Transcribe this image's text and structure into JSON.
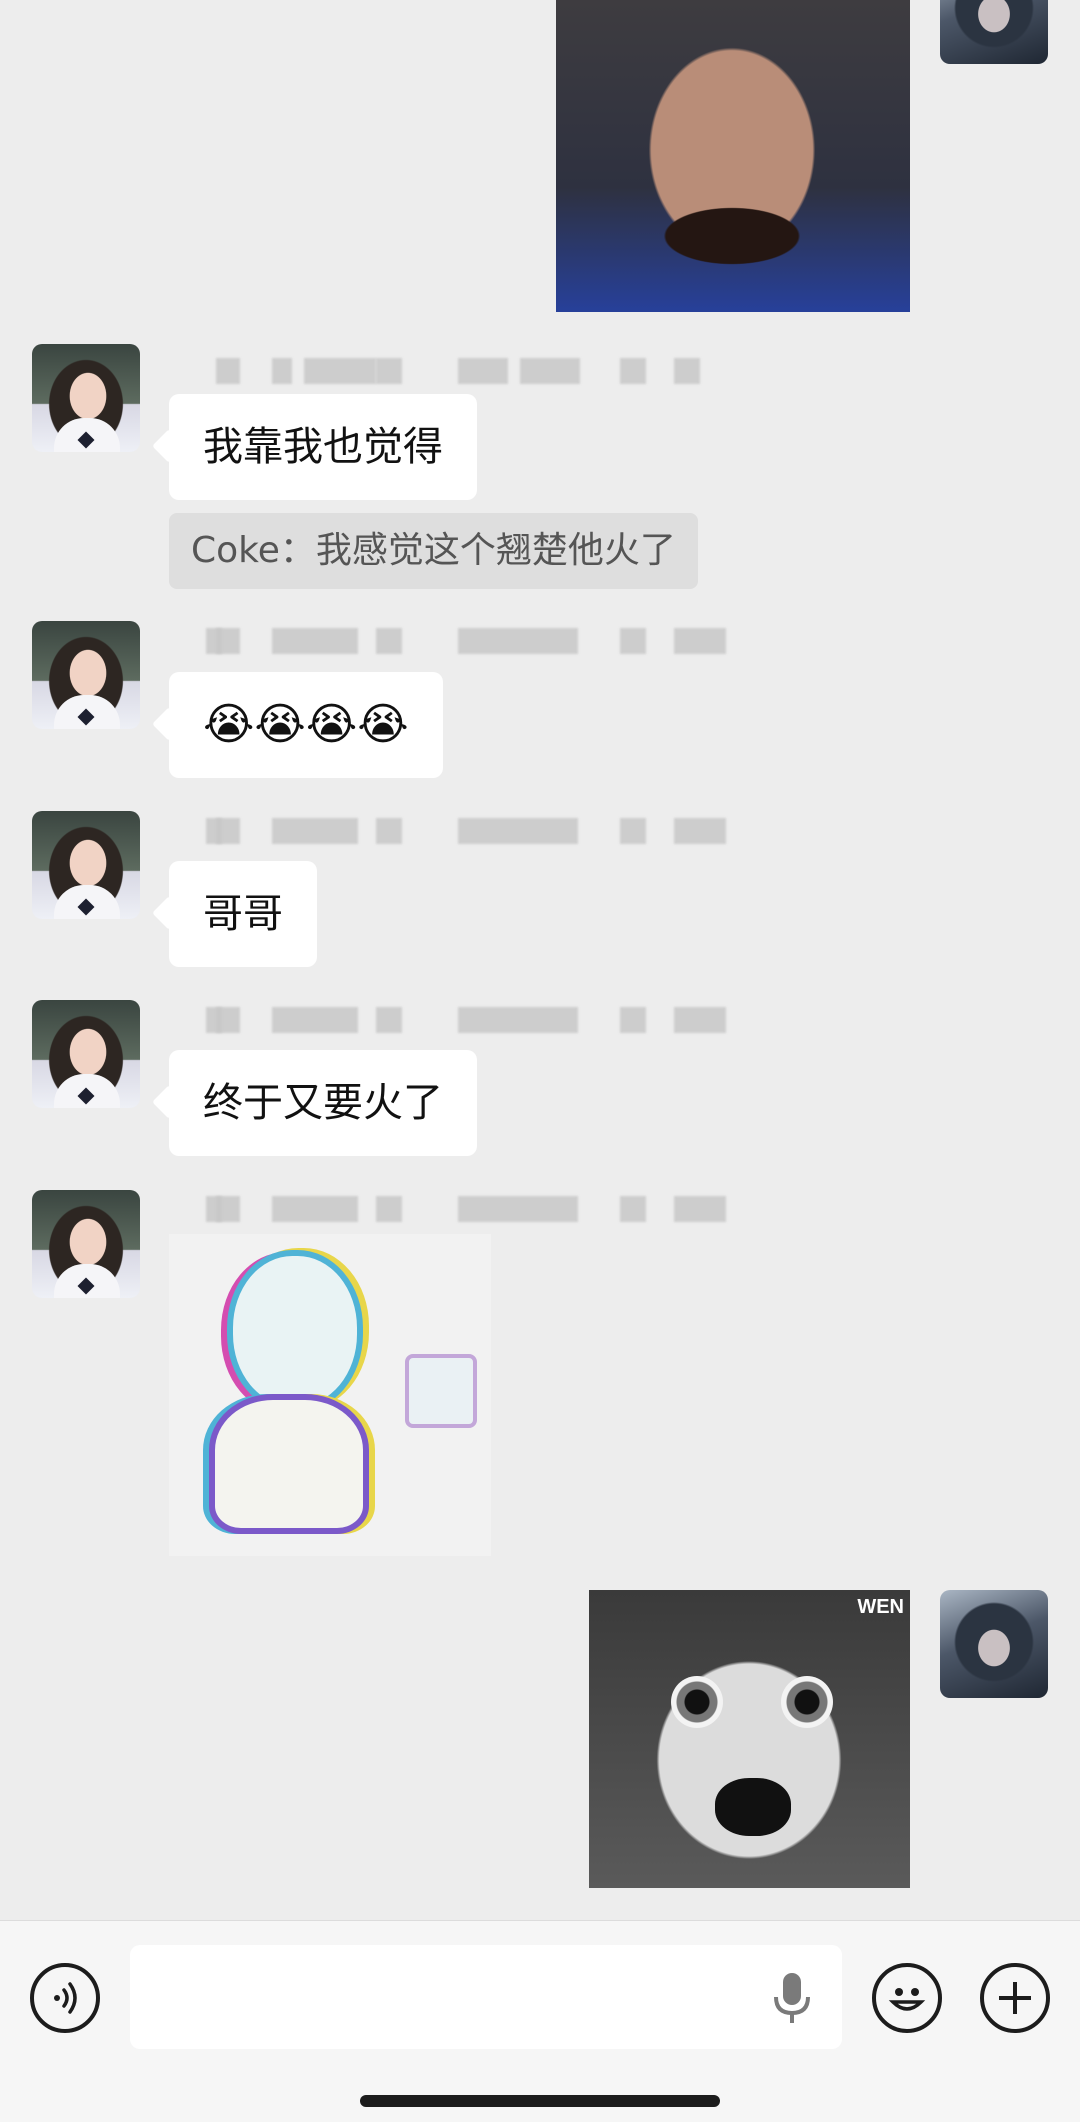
{
  "messages": [
    {
      "sender": "other",
      "text": "我靠我也觉得",
      "quote": "Coke：我感觉这个翘楚他火了"
    },
    {
      "sender": "other",
      "text": "😭😭😭😭"
    },
    {
      "sender": "other",
      "text": "哥哥"
    },
    {
      "sender": "other",
      "text": "终于又要火了"
    }
  ],
  "stickers": {
    "ghost_watermark": "WEN"
  },
  "input_bar": {
    "voice_icon": "voice-mode-icon",
    "mic_icon": "microphone-icon",
    "emoji_icon": "emoji-icon",
    "plus_icon": "add-icon"
  }
}
